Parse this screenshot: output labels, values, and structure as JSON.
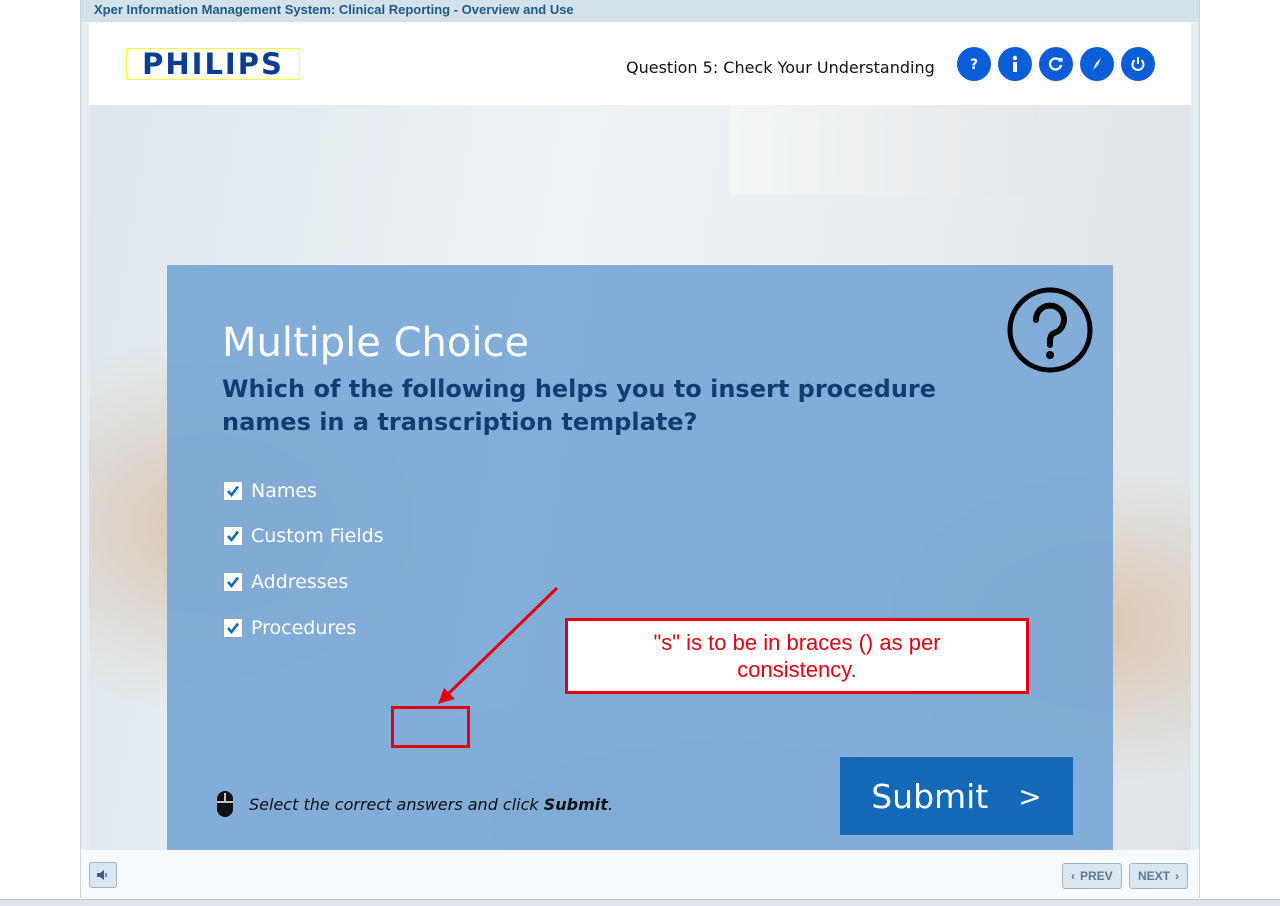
{
  "window": {
    "title": "Xper Information Management System: Clinical Reporting - Overview and Use"
  },
  "header": {
    "logo_text": "PHILIPS",
    "question_title": "Question 5: Check Your Understanding",
    "buttons": [
      {
        "name": "help",
        "glyph": "?",
        "icon": "help-icon"
      },
      {
        "name": "info",
        "glyph": "i",
        "icon": "info-icon"
      },
      {
        "name": "replay",
        "glyph": "↻",
        "icon": "replay-icon"
      },
      {
        "name": "navigate",
        "glyph": "",
        "icon": "compass-icon"
      },
      {
        "name": "exit",
        "glyph": "",
        "icon": "power-icon"
      }
    ]
  },
  "quiz": {
    "title": "Multiple Choice",
    "question": "Which of the following helps you to insert procedure names in a transcription template?",
    "options": [
      {
        "label": "Names",
        "checked": true
      },
      {
        "label": "Custom Fields",
        "checked": true
      },
      {
        "label": "Addresses",
        "checked": true
      },
      {
        "label": "Procedures",
        "checked": true
      }
    ],
    "instruction_pre": "Select the correct answers and click ",
    "instruction_bold": "Submit",
    "instruction_post": ".",
    "submit_label": "Submit",
    "submit_chevron": ">"
  },
  "annotation": {
    "comment": "\"s\" is to be in braces () as per consistency.",
    "color": "#e3000f"
  },
  "footer": {
    "prev_label": "PREV",
    "next_label": "NEXT"
  },
  "colors": {
    "accent": "#0b5ed7",
    "card": "#7aa8d6",
    "question_text": "#0d3f73",
    "submit": "#1468b8"
  }
}
